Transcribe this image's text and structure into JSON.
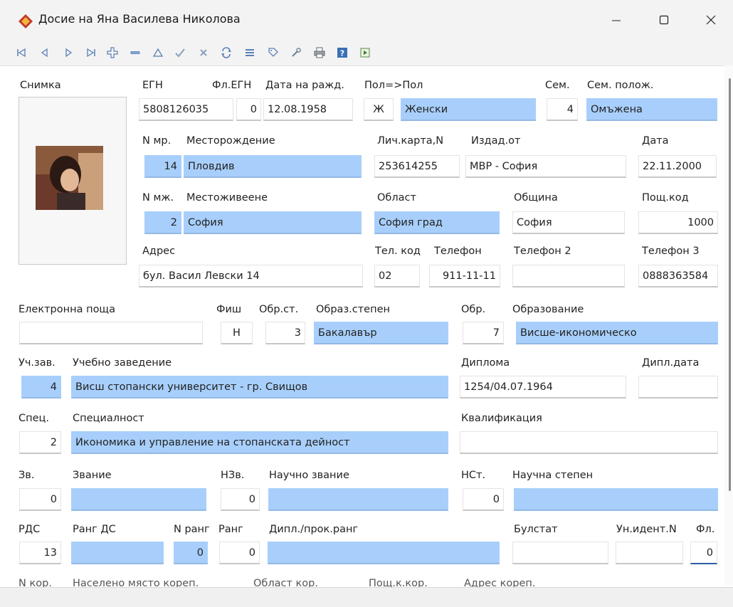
{
  "window": {
    "title": "Досие на Яна Василева Николова"
  },
  "labels": {
    "photo": "Снимка",
    "egn": "ЕГН",
    "fl_egn": "Фл.ЕГН",
    "birth_date": "Дата на ражд.",
    "sex": "Пол=>Пол",
    "fam_code": "Сем.",
    "fam_status": "Сем. полож.",
    "n_birth": "N мр.",
    "birth_place": "Месторождение",
    "id_card": "Лич.карта,N",
    "issued_by": "Издад.от",
    "issue_date": "Дата",
    "n_res": "N мж.",
    "residence": "Местоживеене",
    "region": "Област",
    "municipality": "Община",
    "postcode": "Пощ.код",
    "address": "Адрес",
    "phone_code": "Тел. код",
    "phone": "Телефон",
    "phone2": "Телефон 2",
    "phone3": "Телефон 3",
    "email": "Електронна поща",
    "fish": "Фиш",
    "edu_deg_code": "Обр.ст.",
    "edu_degree": "Образ.степен",
    "edu_code": "Обр.",
    "education": "Образование",
    "uni_code": "Уч.зав.",
    "university": "Учебно заведение",
    "diploma": "Диплома",
    "dipl_date": "Дипл.дата",
    "spec_code": "Спец.",
    "specialty": "Специалност",
    "qualification": "Квалификация",
    "title_code": "Зв.",
    "title": "Звание",
    "sci_title_code": "НЗв.",
    "sci_title": "Научно звание",
    "sci_deg_code": "НСт.",
    "sci_degree": "Научна степен",
    "rds": "РДС",
    "rank_ds": "Ранг ДС",
    "n_rank": "N ранг",
    "rank": "Ранг",
    "dipl_rank": "Дипл./прок.ранг",
    "bulstat": "Булстат",
    "uid": "Ун.идент.N",
    "fl": "Фл.",
    "n_corr": "N кор.",
    "corr_place": "Населено място кореп.",
    "corr_region": "Област кор.",
    "corr_post": "Пощ.к.кор.",
    "corr_address": "Адрес кореп."
  },
  "values": {
    "egn": "5808126035",
    "fl_egn": "0",
    "birth_date": "12.08.1958",
    "sex_code": "Ж",
    "sex": "Женски",
    "fam_code": "4",
    "fam_status": "Омъжена",
    "n_birth": "14",
    "birth_place": "Пловдив",
    "id_card": "253614255",
    "issued_by": "МВР - София",
    "issue_date": "22.11.2000",
    "n_res": "2",
    "residence": "София",
    "region": "София град",
    "municipality": "София",
    "postcode": "1000",
    "address": "бул. Васил Левски 14",
    "phone_code": "02",
    "phone": "911-11-11",
    "phone2": "",
    "phone3": "0888363584",
    "email": "",
    "fish": "Н",
    "edu_deg_code": "3",
    "edu_degree": "Бакалавър",
    "edu_code": "7",
    "education": "Висше-икономическо",
    "uni_code": "4",
    "university": "Висш стопански университет - гр. Свищов",
    "diploma": "1254/04.07.1964",
    "dipl_date": "",
    "spec_code": "2",
    "specialty": "Икономика и управление на стопанската дейност",
    "qualification": "",
    "title_code": "0",
    "title": "",
    "sci_title_code": "0",
    "sci_title": "",
    "sci_deg_code": "0",
    "sci_degree": "",
    "rds": "13",
    "rank_ds": "",
    "n_rank": "0",
    "rank": "0",
    "dipl_rank": "",
    "bulstat": "",
    "uid": "",
    "fl": "0"
  },
  "toolbar_icons": [
    "first-record-icon",
    "prev-record-icon",
    "next-record-icon",
    "last-record-icon",
    "add-record-icon",
    "delete-record-icon",
    "edit-record-icon",
    "post-record-icon",
    "cancel-record-icon",
    "refresh-icon",
    "list-icon",
    "tag-icon",
    "wrench-icon",
    "print-icon",
    "help-icon",
    "export-icon"
  ],
  "colors": {
    "lookup_field": "#a8cffb",
    "active_underline": "#2d5ea8",
    "brand_icon": "#c0392b"
  }
}
